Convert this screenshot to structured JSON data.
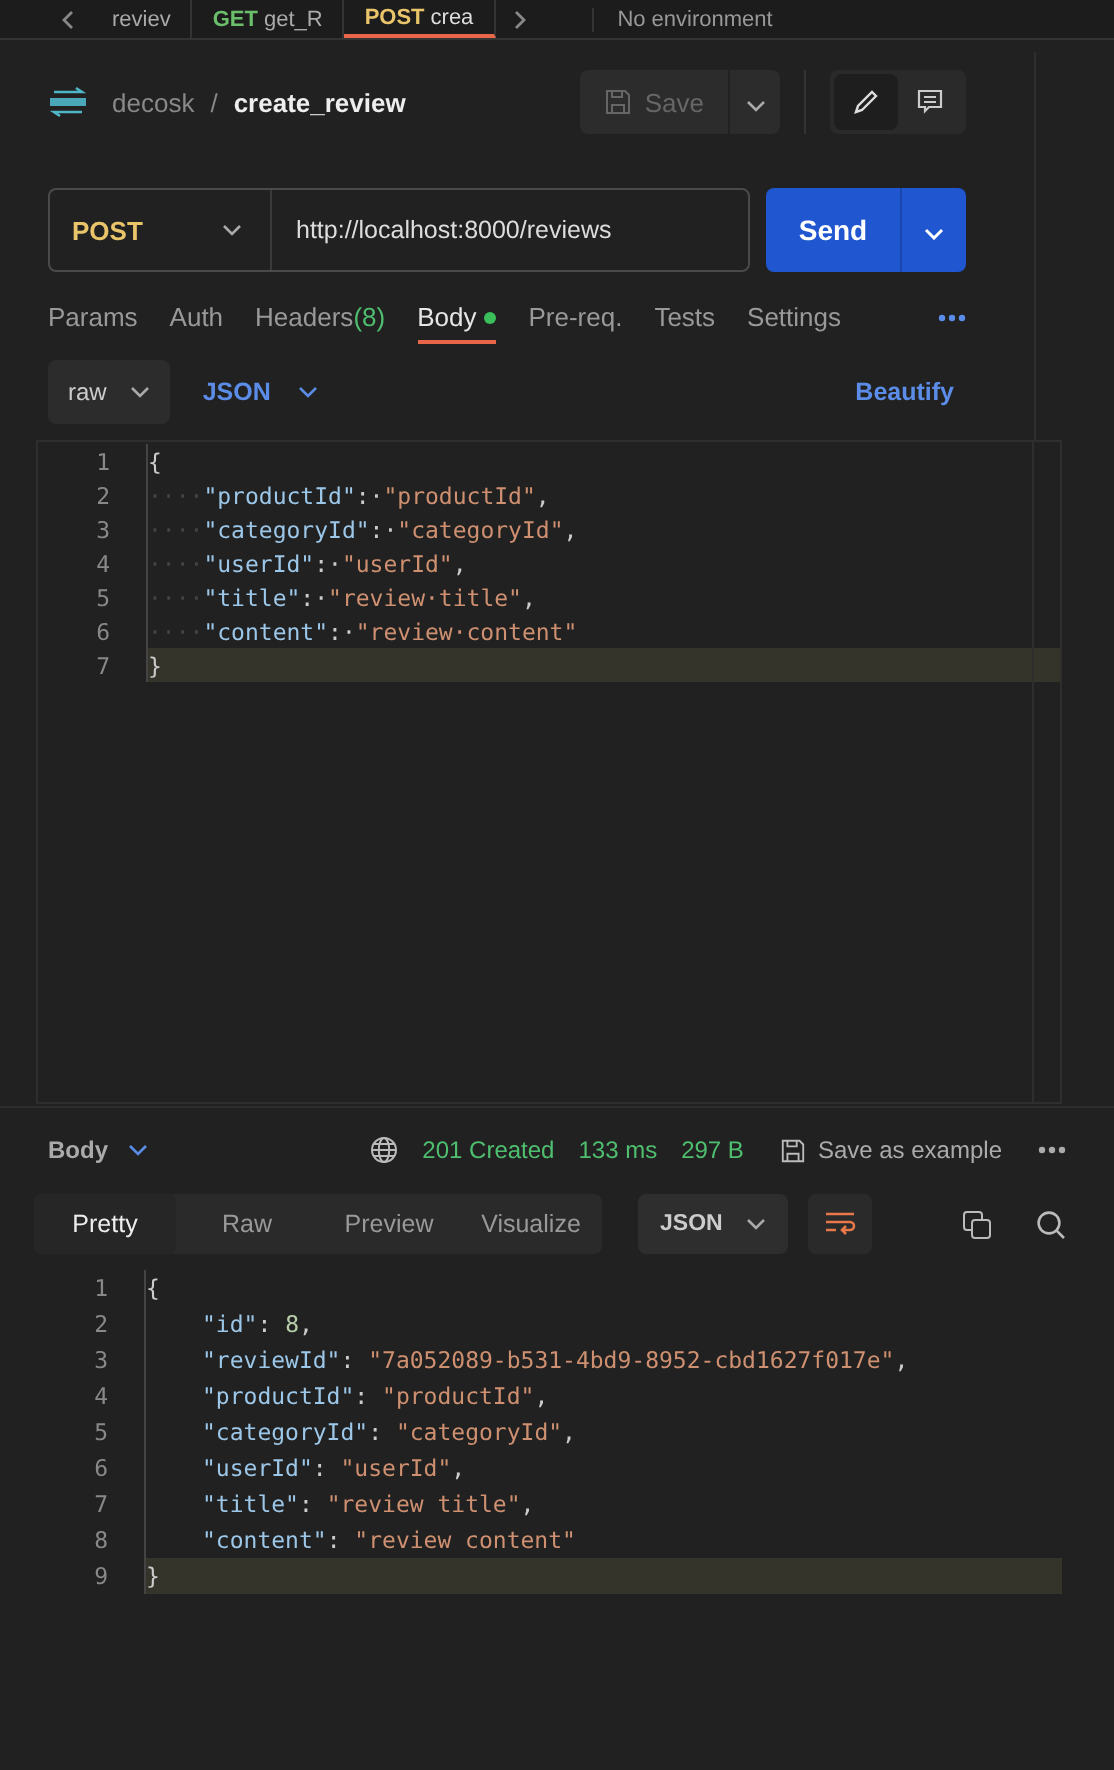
{
  "request_tabs": [
    {
      "name": "reviev",
      "selected": false
    },
    {
      "method": "GET",
      "name": "get_R",
      "selected": false
    },
    {
      "method": "POST",
      "name": "crea",
      "selected": true
    }
  ],
  "environment": "No environment",
  "breadcrumb": {
    "collection": "decosk",
    "separator": "/",
    "request": "create_review"
  },
  "save_button": {
    "label": "Save",
    "disabled": true
  },
  "url_bar": {
    "method": "POST",
    "url": "http://localhost:8000/reviews"
  },
  "send_button": "Send",
  "request_sections": [
    {
      "label": "Params",
      "dot": false,
      "selected": false
    },
    {
      "label": "Auth",
      "dot": false,
      "selected": false
    },
    {
      "label": "Headers",
      "badge": "(8)",
      "dot": false,
      "selected": false
    },
    {
      "label": "Body",
      "dot": true,
      "selected": true
    },
    {
      "label": "Pre-req.",
      "dot": false,
      "selected": false
    },
    {
      "label": "Tests",
      "dot": false,
      "selected": false
    },
    {
      "label": "Settings",
      "dot": false,
      "selected": false
    }
  ],
  "body_mode": "raw",
  "body_language": "JSON",
  "beautify": "Beautify",
  "request_body": [
    {
      "number": "1",
      "current": false,
      "tokens": [
        {
          "kind": "punct",
          "text": "{"
        }
      ]
    },
    {
      "number": "2",
      "current": false,
      "tokens": [
        {
          "kind": "indent",
          "text": "····"
        },
        {
          "kind": "key",
          "text": "\"productId\""
        },
        {
          "kind": "punct",
          "text": ":·"
        },
        {
          "kind": "string",
          "text": "\"productId\""
        },
        {
          "kind": "punct",
          "text": ","
        }
      ]
    },
    {
      "number": "3",
      "current": false,
      "tokens": [
        {
          "kind": "indent",
          "text": "····"
        },
        {
          "kind": "key",
          "text": "\"categoryId\""
        },
        {
          "kind": "punct",
          "text": ":·"
        },
        {
          "kind": "string",
          "text": "\"categoryId\""
        },
        {
          "kind": "punct",
          "text": ","
        }
      ]
    },
    {
      "number": "4",
      "current": false,
      "tokens": [
        {
          "kind": "indent",
          "text": "····"
        },
        {
          "kind": "key",
          "text": "\"userId\""
        },
        {
          "kind": "punct",
          "text": ":·"
        },
        {
          "kind": "string",
          "text": "\"userId\""
        },
        {
          "kind": "punct",
          "text": ","
        }
      ]
    },
    {
      "number": "5",
      "current": false,
      "tokens": [
        {
          "kind": "indent",
          "text": "····"
        },
        {
          "kind": "key",
          "text": "\"title\""
        },
        {
          "kind": "punct",
          "text": ":·"
        },
        {
          "kind": "string",
          "text": "\"review·title\""
        },
        {
          "kind": "punct",
          "text": ","
        }
      ]
    },
    {
      "number": "6",
      "current": false,
      "tokens": [
        {
          "kind": "indent",
          "text": "····"
        },
        {
          "kind": "key",
          "text": "\"content\""
        },
        {
          "kind": "punct",
          "text": ":·"
        },
        {
          "kind": "string",
          "text": "\"review·content\""
        }
      ]
    },
    {
      "number": "7",
      "current": true,
      "tokens": [
        {
          "kind": "punct",
          "text": "}"
        }
      ]
    }
  ],
  "response": {
    "label": "Body",
    "status": "201 Created",
    "time": "133 ms",
    "size": "297 B",
    "save_example": "Save as example",
    "views": [
      {
        "label": "Pretty",
        "selected": true
      },
      {
        "label": "Raw",
        "selected": false
      },
      {
        "label": "Preview",
        "selected": false
      },
      {
        "label": "Visualize",
        "selected": false
      }
    ],
    "format": "JSON",
    "lines": [
      {
        "number": "1",
        "current": false,
        "indented": false,
        "tokens": [
          {
            "kind": "punct",
            "text": "{"
          }
        ]
      },
      {
        "number": "2",
        "current": false,
        "indented": true,
        "tokens": [
          {
            "kind": "key",
            "text": "\"id\""
          },
          {
            "kind": "punct",
            "text": ": "
          },
          {
            "kind": "number",
            "text": "8"
          },
          {
            "kind": "punct",
            "text": ","
          }
        ]
      },
      {
        "number": "3",
        "current": false,
        "indented": true,
        "tokens": [
          {
            "kind": "key",
            "text": "\"reviewId\""
          },
          {
            "kind": "punct",
            "text": ": "
          },
          {
            "kind": "string",
            "text": "\"7a052089-b531-4bd9-8952-cbd1627f017e\""
          },
          {
            "kind": "punct",
            "text": ","
          }
        ]
      },
      {
        "number": "4",
        "current": false,
        "indented": true,
        "tokens": [
          {
            "kind": "key",
            "text": "\"productId\""
          },
          {
            "kind": "punct",
            "text": ": "
          },
          {
            "kind": "string",
            "text": "\"productId\""
          },
          {
            "kind": "punct",
            "text": ","
          }
        ]
      },
      {
        "number": "5",
        "current": false,
        "indented": true,
        "tokens": [
          {
            "kind": "key",
            "text": "\"categoryId\""
          },
          {
            "kind": "punct",
            "text": ": "
          },
          {
            "kind": "string",
            "text": "\"categoryId\""
          },
          {
            "kind": "punct",
            "text": ","
          }
        ]
      },
      {
        "number": "6",
        "current": false,
        "indented": true,
        "tokens": [
          {
            "kind": "key",
            "text": "\"userId\""
          },
          {
            "kind": "punct",
            "text": ": "
          },
          {
            "kind": "string",
            "text": "\"userId\""
          },
          {
            "kind": "punct",
            "text": ","
          }
        ]
      },
      {
        "number": "7",
        "current": false,
        "indented": true,
        "tokens": [
          {
            "kind": "key",
            "text": "\"title\""
          },
          {
            "kind": "punct",
            "text": ": "
          },
          {
            "kind": "string",
            "text": "\"review title\""
          },
          {
            "kind": "punct",
            "text": ","
          }
        ]
      },
      {
        "number": "8",
        "current": false,
        "indented": true,
        "tokens": [
          {
            "kind": "key",
            "text": "\"content\""
          },
          {
            "kind": "punct",
            "text": ": "
          },
          {
            "kind": "string",
            "text": "\"review content\""
          }
        ]
      },
      {
        "number": "9",
        "current": true,
        "indented": false,
        "tokens": [
          {
            "kind": "punct",
            "text": "}"
          }
        ]
      }
    ]
  }
}
